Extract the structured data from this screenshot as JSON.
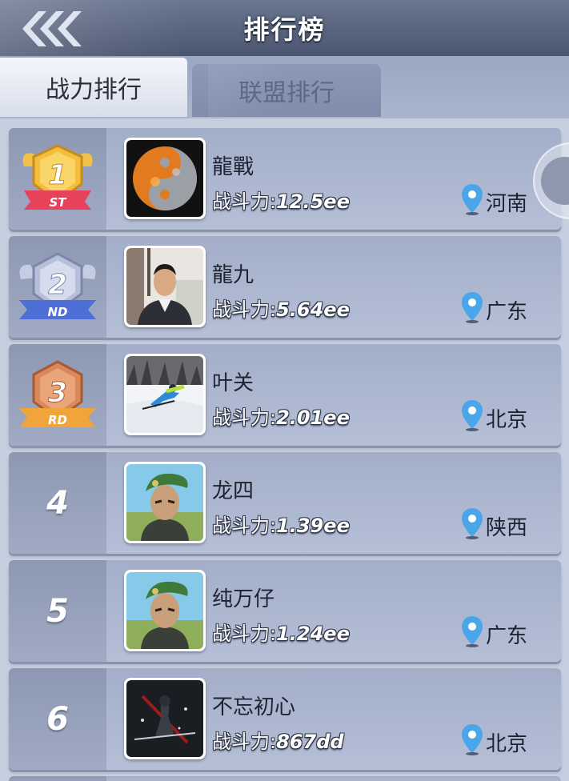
{
  "header": {
    "title": "排行榜"
  },
  "tabs": [
    {
      "label": "战力排行",
      "active": true
    },
    {
      "label": "联盟排行",
      "active": false
    }
  ],
  "power_label": "战斗力:",
  "players": [
    {
      "rank": "1",
      "badge": "ST",
      "name": "龍戰",
      "power": "12.5ee",
      "location": "河南",
      "avatar": "yin-yang-icon"
    },
    {
      "rank": "2",
      "badge": "ND",
      "name": "龍九",
      "power": "5.64ee",
      "location": "广东",
      "avatar": "man-portrait"
    },
    {
      "rank": "3",
      "badge": "RD",
      "name": "叶关",
      "power": "2.01ee",
      "location": "北京",
      "avatar": "skier-photo"
    },
    {
      "rank": "4",
      "name": "龙四",
      "power": "1.39ee",
      "location": "陕西",
      "avatar": "soldier-green-beret"
    },
    {
      "rank": "5",
      "name": "纯万仔",
      "power": "1.24ee",
      "location": "广东",
      "avatar": "soldier-green-beret"
    },
    {
      "rank": "6",
      "name": "不忘初心",
      "power": "867dd",
      "location": "北京",
      "avatar": "dark-warrior"
    }
  ],
  "colors": {
    "gold": "#f2b93b",
    "silver": "#9aa6c4",
    "bronze": "#d98a5a",
    "location_pin": "#4aa6e8"
  }
}
